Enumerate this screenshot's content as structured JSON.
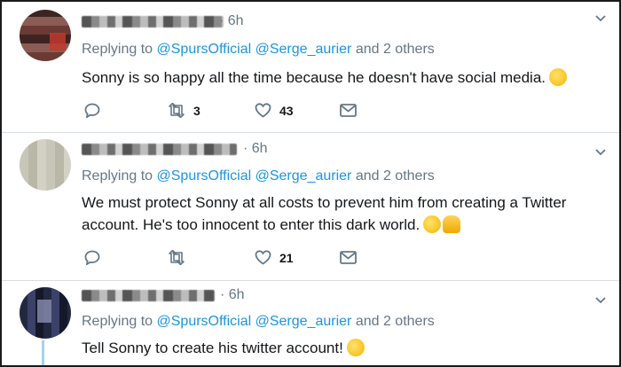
{
  "tweets": [
    {
      "time": "· 6h",
      "replying_label": "Replying to",
      "mention1": "@SpursOfficial",
      "mention2": "@Serge_aurier",
      "others": "and 2 others",
      "text": "Sonny is so happy all the time because he doesn't have social media.",
      "emoji": "rolling-on-floor-laughing-emoji",
      "retweets": "3",
      "likes": "43"
    },
    {
      "time": "· 6h",
      "replying_label": "Replying to",
      "mention1": "@SpursOfficial",
      "mention2": "@Serge_aurier",
      "others": "and 2 others",
      "text_line1": "We must protect Sonny at all costs to prevent him from creating a Twitter",
      "text_line2": "account. He's too innocent to enter this dark world.",
      "emoji": [
        "laughing-emoji",
        "folded-hands-emoji"
      ],
      "retweets": "",
      "likes": "21"
    },
    {
      "time": "· 6h",
      "replying_label": "Replying to",
      "mention1": "@SpursOfficial",
      "mention2": "@Serge_aurier",
      "others": "and 2 others",
      "text": "Tell Sonny to create his twitter account!",
      "emoji": "face-with-tears-of-joy-emoji"
    }
  ],
  "colors": {
    "mention": "#1b95e0",
    "muted": "#657786",
    "text": "#14171a",
    "divider": "#d9dee3"
  }
}
